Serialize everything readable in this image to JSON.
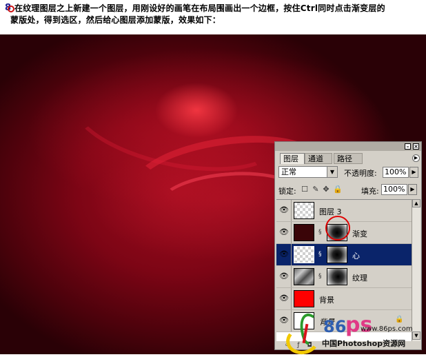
{
  "instruction": {
    "step_number": "8",
    "line1": "在纹理图层之上新建一个图层，用刚设好的画笔在布局围画出一个边框，按住Ctrl同时点击渐变层的",
    "line2": "蒙版处，得到选区，然后给心图层添加蒙版，效果如下："
  },
  "palette": {
    "tabs": [
      "图层",
      "通道",
      "路径"
    ],
    "blend_mode": "正常",
    "opacity_label": "不透明度:",
    "opacity_value": "100%",
    "lock_label": "锁定:",
    "fill_label": "填充:",
    "fill_value": "100%",
    "layers": [
      {
        "name": "图层 3",
        "visible": true,
        "selected": false,
        "thumb": "transparent",
        "mask": null
      },
      {
        "name": "渐变",
        "visible": true,
        "selected": false,
        "thumb": "dark-red",
        "mask": "radial-gradient"
      },
      {
        "name": "心",
        "visible": true,
        "selected": true,
        "thumb": "transparent",
        "mask": "radial-gradient"
      },
      {
        "name": "纹理",
        "visible": true,
        "selected": false,
        "thumb": "texture",
        "mask": "radial-gradient"
      },
      {
        "name": "背景",
        "visible": true,
        "selected": false,
        "thumb": "red",
        "mask": null
      },
      {
        "name": "背景",
        "visible": true,
        "selected": false,
        "thumb": "white-line",
        "mask": null,
        "locked": true
      }
    ],
    "colors": {
      "selection": "#0a246a",
      "panel": "#d4d0c8",
      "highlight_circle": "#e00000"
    }
  },
  "watermark": {
    "logo_text_86": "86",
    "logo_text_ps": "ps",
    "url": "www.86ps.com",
    "site_name": "中国Photoshop资源网"
  }
}
